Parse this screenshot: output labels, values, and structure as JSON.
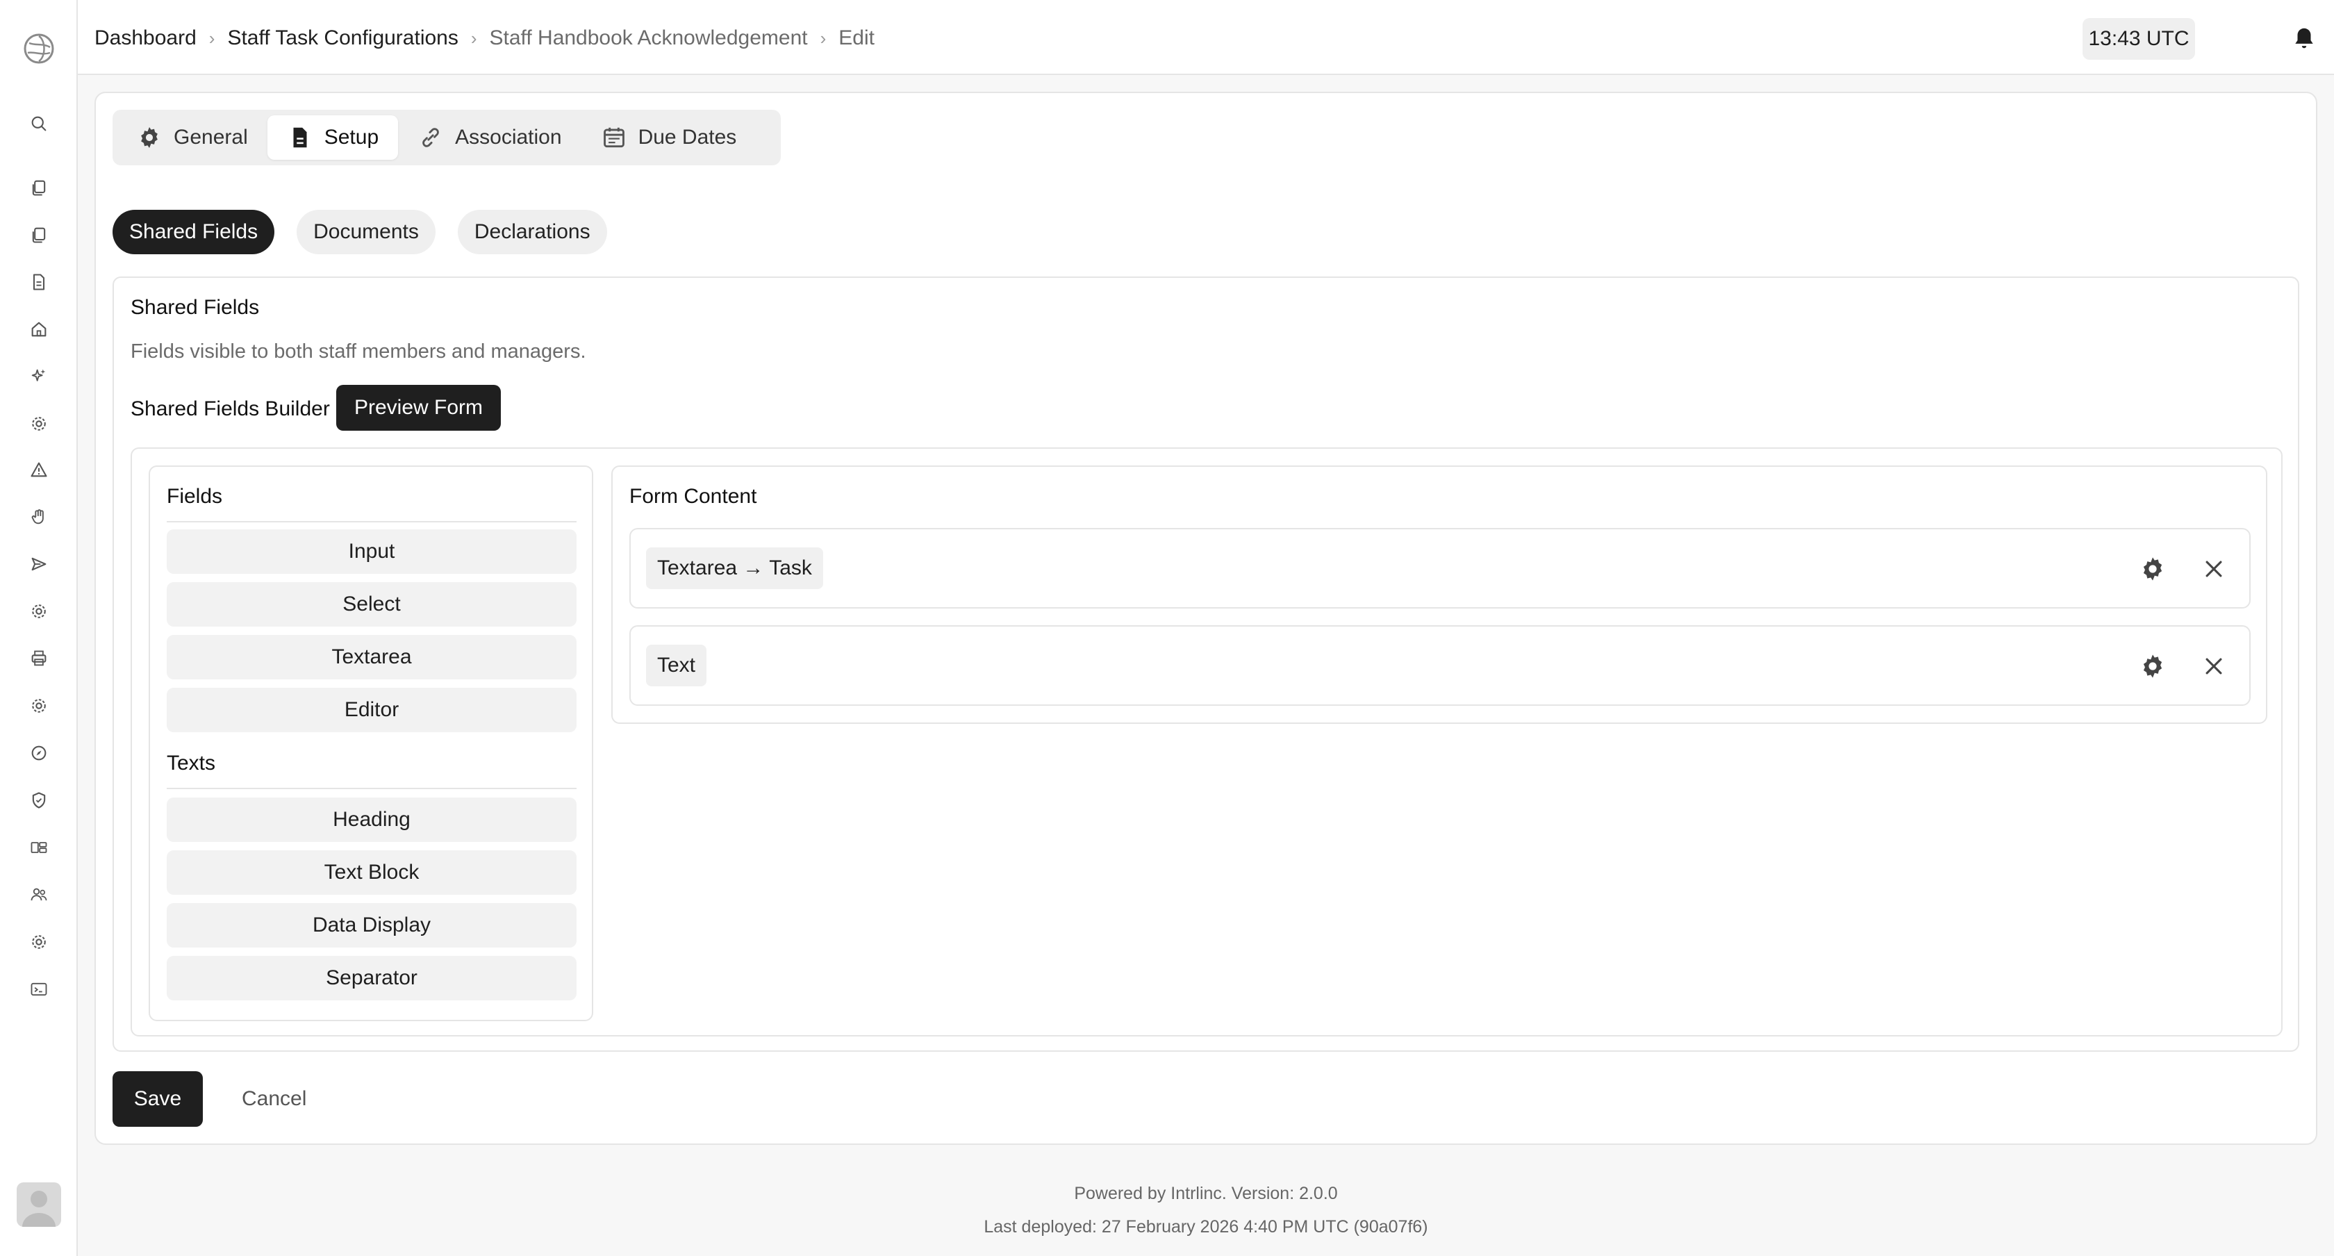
{
  "breadcrumb": {
    "items": [
      "Dashboard",
      "Staff Task Configurations",
      "Staff Handbook Acknowledgement",
      "Edit"
    ]
  },
  "header": {
    "time": "13:43 UTC"
  },
  "tabs": {
    "items": [
      "General",
      "Setup",
      "Association",
      "Due Dates"
    ],
    "active": "Setup"
  },
  "subtabs": {
    "items": [
      "Shared Fields",
      "Documents",
      "Declarations"
    ],
    "active": "Shared Fields"
  },
  "section": {
    "title": "Shared Fields",
    "description": "Fields visible to both staff members and managers.",
    "builder_label": "Shared Fields Builder",
    "preview_label": "Preview Form"
  },
  "palette": {
    "fields_heading": "Fields",
    "fields": [
      "Input",
      "Select",
      "Textarea",
      "Editor"
    ],
    "texts_heading": "Texts",
    "texts": [
      "Heading",
      "Text Block",
      "Data Display",
      "Separator"
    ]
  },
  "form_content": {
    "title": "Form Content",
    "rows": [
      {
        "label": "Textarea → Task"
      },
      {
        "label": "Text"
      }
    ]
  },
  "actions": {
    "save_label": "Save",
    "cancel_label": "Cancel"
  },
  "footer": {
    "powered": "Powered by Intrlinc. Version: 2.0.0",
    "deployed": "Last deployed: 27 February 2026 4:40 PM UTC (90a07f6)"
  },
  "sidebar": {
    "icons": [
      "search-icon",
      "copy-icon",
      "copy-icon",
      "document-icon",
      "home-icon",
      "sparkle-icon",
      "gear-icon",
      "warning-icon",
      "hand-icon",
      "send-icon",
      "gear-icon",
      "printer-icon",
      "gear-icon",
      "compass-icon",
      "shield-icon",
      "layout-icon",
      "users-icon",
      "gear-icon",
      "terminal-icon"
    ]
  },
  "colors": {
    "accent": "#1f1f1f",
    "muted_surface": "#efefef",
    "border": "#e5e5e5"
  }
}
